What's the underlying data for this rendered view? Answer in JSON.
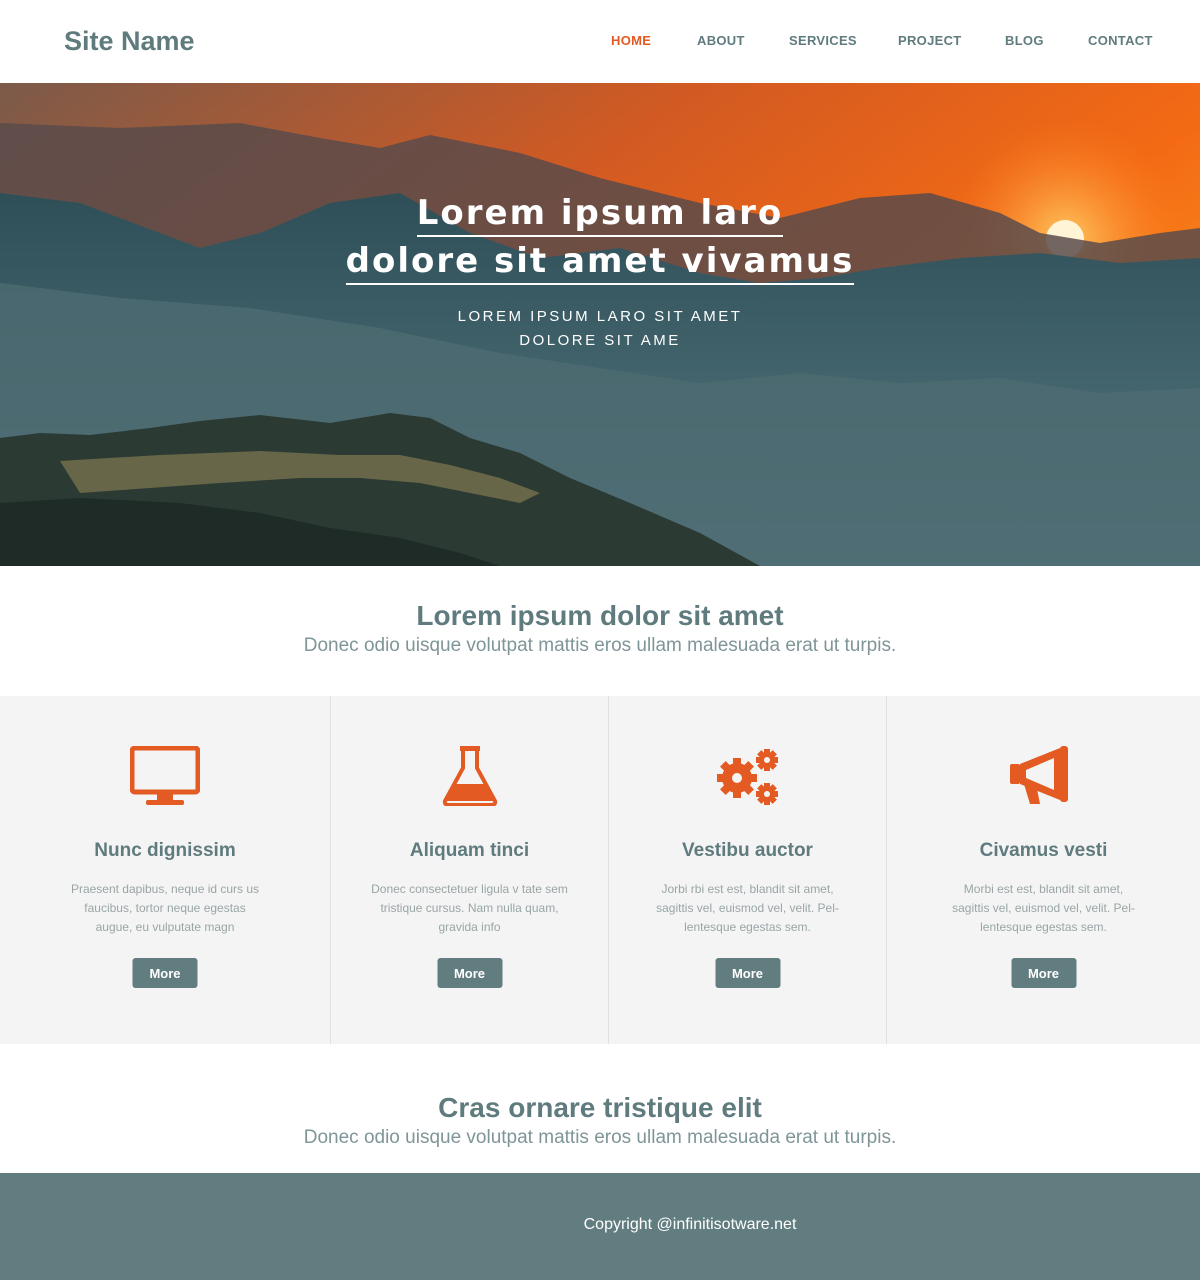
{
  "header": {
    "site_name": "Site Name",
    "nav": [
      {
        "label": "HOME",
        "active": true
      },
      {
        "label": "ABOUT",
        "active": false
      },
      {
        "label": "SERVICES",
        "active": false
      },
      {
        "label": "PROJECT",
        "active": false
      },
      {
        "label": "BLOG",
        "active": false
      },
      {
        "label": "CONTACT",
        "active": false
      }
    ]
  },
  "hero": {
    "title_line1": "Lorem ipsum laro",
    "title_line2": "dolore sit amet vivamus",
    "subtitle_line1": "LOREM IPSUM LARO SIT AMET",
    "subtitle_line2": "DOLORE SIT AME"
  },
  "intro": {
    "title": "Lorem ipsum dolor sit amet",
    "text": "Donec odio uisque volutpat mattis eros ullam malesuada erat ut turpis."
  },
  "features": [
    {
      "icon": "monitor-icon",
      "title": "Nunc dignissim",
      "text": "Praesent dapibus, neque id curs us faucibus, tortor neque egestas augue, eu vulputate magn",
      "button": "More"
    },
    {
      "icon": "flask-icon",
      "title": "Aliquam tinci",
      "text": "Donec consectetuer ligula v tate sem tristique cursus. Nam nulla quam, gravida info",
      "button": "More"
    },
    {
      "icon": "gears-icon",
      "title": "Vestibu auctor",
      "text": "Jorbi rbi est est, blandit sit amet, sagittis vel, euismod vel, velit. Pel- lentesque egestas sem.",
      "button": "More"
    },
    {
      "icon": "megaphone-icon",
      "title": "Civamus vesti",
      "text": "Morbi est est, blandit sit amet, sagittis vel, euismod vel, velit. Pel- lentesque egestas sem.",
      "button": "More"
    }
  ],
  "second": {
    "title": "Cras ornare tristique elit",
    "text": "Donec odio uisque volutpat mattis eros ullam malesuada erat ut turpis."
  },
  "footer": {
    "copyright": "Copyright @infinitisotware.net"
  },
  "colors": {
    "accent": "#e35a22",
    "primary": "#5f7b7e",
    "footer": "#627d80",
    "feature_bg": "#f4f4f4"
  }
}
